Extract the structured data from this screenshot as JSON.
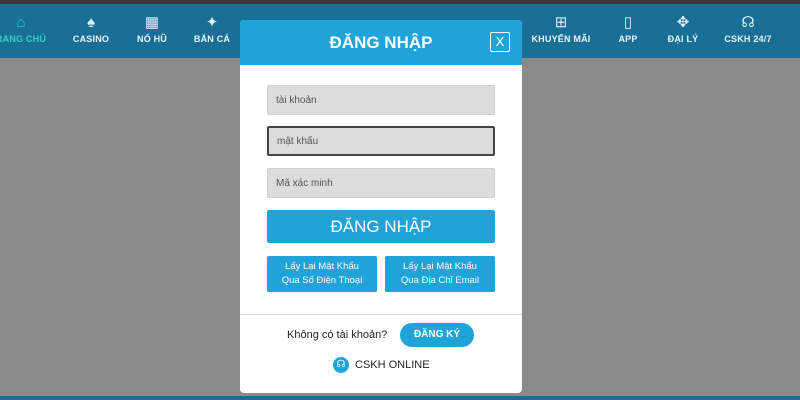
{
  "nav": {
    "items": [
      {
        "label": "RANG CHỦ",
        "icon": "⌂"
      },
      {
        "label": "CASINO",
        "icon": "♠"
      },
      {
        "label": "NỔ HŨ",
        "icon": "▦"
      },
      {
        "label": "BẮN CÁ",
        "icon": "✦"
      },
      {
        "label": "KHUYẾN MÃI",
        "icon": "⊞"
      },
      {
        "label": "APP",
        "icon": "▯"
      },
      {
        "label": "ĐẠI LÝ",
        "icon": "✥"
      },
      {
        "label": "CSKH 24/7",
        "icon": "☊"
      }
    ]
  },
  "modal": {
    "title": "ĐĂNG NHẬP",
    "close_icon": "X",
    "fields": {
      "username_placeholder": "tài khoản",
      "password_placeholder": "mật khẩu",
      "captcha_placeholder": "Mã xác minh"
    },
    "login_button": "ĐĂNG NHẬP",
    "recover_phone_line1": "Lấy Lại Mật Khẩu",
    "recover_phone_line2": "Qua Số Điện Thoại",
    "recover_email_line1": "Lấy Lại Mật Khẩu",
    "recover_email_line2": "Qua Địa Chỉ Email",
    "no_account_text": "Không có tài khoản?",
    "register_button": "ĐĂNG KÝ",
    "support_label": "CSKH ONLINE"
  },
  "colors": {
    "accent": "#1fa3d8",
    "topbar": "#1a6f96",
    "overlay": "#8a8a8a"
  }
}
